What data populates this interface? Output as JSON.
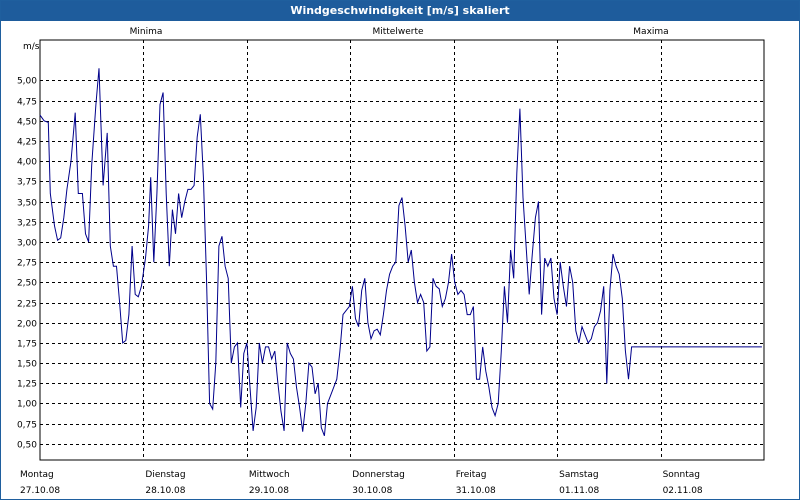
{
  "window": {
    "title": "Windgeschwindigkeit [m/s] skaliert"
  },
  "legend": {
    "min": {
      "label": "Minima",
      "color": "#00a000"
    },
    "mean": {
      "label": "Mittelwerte",
      "color": "#2020c0"
    },
    "max": {
      "label": "Maxima",
      "color": "#c00000"
    }
  },
  "chart_data": {
    "type": "line",
    "title": "Windgeschwindigkeit [m/s] skaliert",
    "ylabel": "m/s",
    "xlabel": "",
    "ylim": [
      0.3,
      5.5
    ],
    "xlim": [
      0,
      7
    ],
    "yticks": [
      0.5,
      0.75,
      1.0,
      1.25,
      1.5,
      1.75,
      2.0,
      2.25,
      2.5,
      2.75,
      3.0,
      3.25,
      3.5,
      3.75,
      4.0,
      4.25,
      4.5,
      4.75,
      5.0
    ],
    "ytick_labels": [
      "0,50",
      "0,75",
      "1,00",
      "1,25",
      "1,50",
      "1,75",
      "2,00",
      "2,25",
      "2,50",
      "2,75",
      "3,00",
      "3,25",
      "3,50",
      "3,75",
      "4,00",
      "4,25",
      "4,50",
      "4,75",
      "5,00"
    ],
    "days": [
      {
        "name": "Montag",
        "date": "27.10.08"
      },
      {
        "name": "Dienstag",
        "date": "28.10.08"
      },
      {
        "name": "Mittwoch",
        "date": "29.10.08"
      },
      {
        "name": "Donnerstag",
        "date": "30.10.08"
      },
      {
        "name": "Freitag",
        "date": "31.10.08"
      },
      {
        "name": "Samstag",
        "date": "01.11.08"
      },
      {
        "name": "Sonntag",
        "date": "02.11.08"
      }
    ],
    "grid": true,
    "series": [
      {
        "name": "Mittelwerte",
        "color": "#00008b",
        "x": [
          0.0,
          0.04,
          0.08,
          0.1,
          0.14,
          0.17,
          0.2,
          0.23,
          0.26,
          0.3,
          0.34,
          0.37,
          0.41,
          0.44,
          0.47,
          0.5,
          0.54,
          0.57,
          0.61,
          0.65,
          0.68,
          0.71,
          0.74,
          0.77,
          0.8,
          0.83,
          0.86,
          0.89,
          0.92,
          0.95,
          0.98,
          1.02,
          1.05,
          1.07,
          1.1,
          1.13,
          1.16,
          1.19,
          1.22,
          1.25,
          1.28,
          1.31,
          1.34,
          1.37,
          1.4,
          1.43,
          1.46,
          1.49,
          1.52,
          1.55,
          1.58,
          1.61,
          1.64,
          1.67,
          1.7,
          1.73,
          1.76,
          1.79,
          1.82,
          1.85,
          1.88,
          1.91,
          1.94,
          1.97,
          2.0,
          2.03,
          2.06,
          2.09,
          2.12,
          2.15,
          2.18,
          2.21,
          2.24,
          2.27,
          2.3,
          2.33,
          2.36,
          2.39,
          2.42,
          2.45,
          2.48,
          2.51,
          2.54,
          2.57,
          2.6,
          2.63,
          2.66,
          2.69,
          2.72,
          2.75,
          2.78,
          2.81,
          2.84,
          2.87,
          2.9,
          2.93,
          2.96,
          2.99,
          3.02,
          3.05,
          3.08,
          3.11,
          3.14,
          3.17,
          3.2,
          3.23,
          3.26,
          3.29,
          3.32,
          3.35,
          3.38,
          3.41,
          3.44,
          3.47,
          3.5,
          3.53,
          3.56,
          3.59,
          3.62,
          3.65,
          3.68,
          3.71,
          3.74,
          3.77,
          3.8,
          3.83,
          3.86,
          3.89,
          3.92,
          3.95,
          3.98,
          4.01,
          4.04,
          4.07,
          4.1,
          4.13,
          4.16,
          4.19,
          4.22,
          4.25,
          4.28,
          4.31,
          4.34,
          4.37,
          4.4,
          4.43,
          4.46,
          4.49,
          4.52,
          4.55,
          4.58,
          4.61,
          4.64,
          4.67,
          4.7,
          4.73,
          4.76,
          4.79,
          4.82,
          4.85,
          4.88,
          4.91,
          4.94,
          4.97,
          5.0,
          5.03,
          5.06,
          5.09,
          5.12,
          5.15,
          5.18,
          5.21,
          5.24,
          5.27,
          5.3,
          5.33,
          5.36,
          5.39,
          5.42,
          5.45,
          5.48,
          5.51,
          5.54,
          5.57,
          5.6,
          5.63,
          5.66,
          5.69,
          5.72,
          5.75,
          5.78,
          5.81,
          5.84,
          5.87,
          5.9,
          5.93,
          5.96,
          5.99,
          6.02,
          6.05,
          6.08,
          6.11,
          6.14,
          6.17,
          6.2,
          6.23,
          6.26,
          6.29,
          6.32,
          6.35,
          6.38,
          6.41,
          6.44,
          6.47,
          6.5,
          6.53,
          6.56,
          6.59,
          6.62,
          6.65,
          6.68,
          6.71,
          6.74,
          6.77,
          6.8,
          6.83,
          6.86,
          6.89,
          6.92,
          6.95,
          6.98
        ],
        "values": [
          4.57,
          4.5,
          4.48,
          3.6,
          3.2,
          3.02,
          3.05,
          3.3,
          3.65,
          4.0,
          4.6,
          3.6,
          3.6,
          3.1,
          3.0,
          3.95,
          4.7,
          5.15,
          3.7,
          4.35,
          2.95,
          2.7,
          2.7,
          2.25,
          1.75,
          1.78,
          2.1,
          2.95,
          2.35,
          2.32,
          2.45,
          2.8,
          3.2,
          3.8,
          2.75,
          3.6,
          4.7,
          4.85,
          3.6,
          2.7,
          3.4,
          3.1,
          3.6,
          3.3,
          3.5,
          3.65,
          3.65,
          3.7,
          4.3,
          4.58,
          3.8,
          2.55,
          1.0,
          0.93,
          1.5,
          2.95,
          3.07,
          2.7,
          2.55,
          1.5,
          1.7,
          1.75,
          0.95,
          1.62,
          1.75,
          1.2,
          0.66,
          0.95,
          1.75,
          1.5,
          1.7,
          1.7,
          1.55,
          1.65,
          1.25,
          0.9,
          0.66,
          1.75,
          1.62,
          1.55,
          1.2,
          0.95,
          0.65,
          1.0,
          1.5,
          1.45,
          1.12,
          1.25,
          0.7,
          0.6,
          1.0,
          1.1,
          1.2,
          1.3,
          1.65,
          2.1,
          2.15,
          2.2,
          2.45,
          2.05,
          1.95,
          2.4,
          2.55,
          2.0,
          1.8,
          1.9,
          1.92,
          1.85,
          2.1,
          2.4,
          2.6,
          2.7,
          2.75,
          3.45,
          3.55,
          3.2,
          2.75,
          2.9,
          2.5,
          2.25,
          2.35,
          2.25,
          1.65,
          1.7,
          2.55,
          2.45,
          2.42,
          2.2,
          2.3,
          2.5,
          2.85,
          2.5,
          2.35,
          2.4,
          2.35,
          2.1,
          2.1,
          2.2,
          1.3,
          1.3,
          1.7,
          1.4,
          1.2,
          0.95,
          0.85,
          1.0,
          1.65,
          2.45,
          2.0,
          2.9,
          2.55,
          3.85,
          4.65,
          3.55,
          2.95,
          2.35,
          2.85,
          3.3,
          3.5,
          2.1,
          2.8,
          2.7,
          2.8,
          2.3,
          2.1,
          2.75,
          2.45,
          2.2,
          2.7,
          2.5,
          1.9,
          1.75,
          1.95,
          1.85,
          1.75,
          1.8,
          1.95,
          2.0,
          2.15,
          2.45,
          1.25,
          2.4,
          2.85,
          2.7,
          2.6,
          2.3,
          1.65,
          1.3,
          1.7,
          1.7,
          1.7,
          1.7,
          1.7,
          1.7,
          1.7,
          1.7,
          1.7,
          1.7,
          1.7,
          1.7,
          1.7,
          1.7,
          1.7,
          1.7,
          1.7,
          1.7,
          1.7,
          1.7,
          1.7,
          1.7,
          1.7,
          1.7,
          1.7,
          1.7,
          1.7,
          1.7,
          1.7,
          1.7,
          1.7,
          1.7,
          1.7,
          1.7,
          1.7,
          1.7,
          1.7,
          1.7,
          1.7,
          1.7,
          1.7,
          1.7,
          1.7
        ]
      }
    ]
  }
}
